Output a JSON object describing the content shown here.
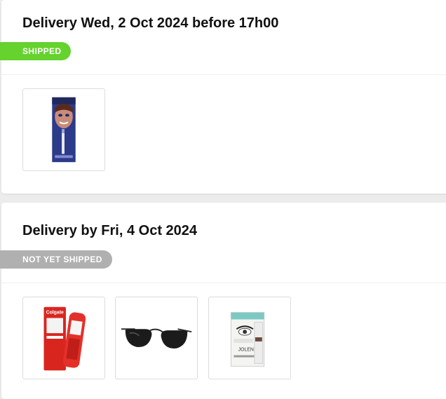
{
  "shipments": [
    {
      "delivery_title": "Delivery Wed, 2 Oct 2024 before 17h00",
      "status": "SHIPPED",
      "status_color": "#65d22e",
      "products": [
        {
          "name": "teeth whitening pen box",
          "icon": "whitening-pen-box-icon"
        }
      ]
    },
    {
      "delivery_title": "Delivery by Fri, 4 Oct 2024",
      "status": "NOT YET SHIPPED",
      "status_color": "#b0b0b0",
      "products": [
        {
          "name": "Colgate toothpaste",
          "icon": "toothpaste-icon",
          "brand_text": "Colgate"
        },
        {
          "name": "aviator sunglasses",
          "icon": "sunglasses-icon"
        },
        {
          "name": "brow tint kit",
          "icon": "brow-kit-icon",
          "brand_text": "JOLENE"
        }
      ]
    }
  ]
}
